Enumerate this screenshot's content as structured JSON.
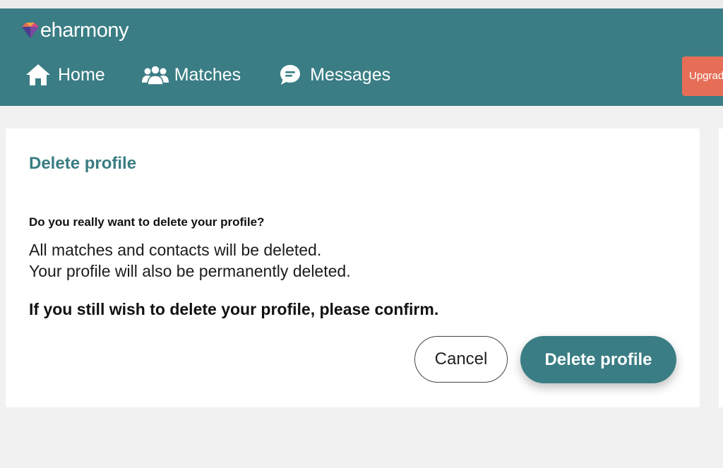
{
  "colors": {
    "brand": "#3a7d84",
    "upgrade": "#e66e56",
    "background": "#f1f1f1"
  },
  "header": {
    "logo_text": "eharmony",
    "logo_icon": "eharmony-heart-icon",
    "nav": [
      {
        "label": "Home",
        "icon": "home-icon"
      },
      {
        "label": "Matches",
        "icon": "people-icon"
      },
      {
        "label": "Messages",
        "icon": "chat-bubble-icon"
      }
    ],
    "upgrade_label": "Upgrade"
  },
  "dialog": {
    "title": "Delete profile",
    "question": "Do you really want to delete your profile?",
    "line1": "All matches and contacts will be deleted.",
    "line2": "Your profile will also be permanently deleted.",
    "confirm_text": "If you still wish to delete your profile, please confirm.",
    "cancel_label": "Cancel",
    "delete_label": "Delete profile"
  }
}
